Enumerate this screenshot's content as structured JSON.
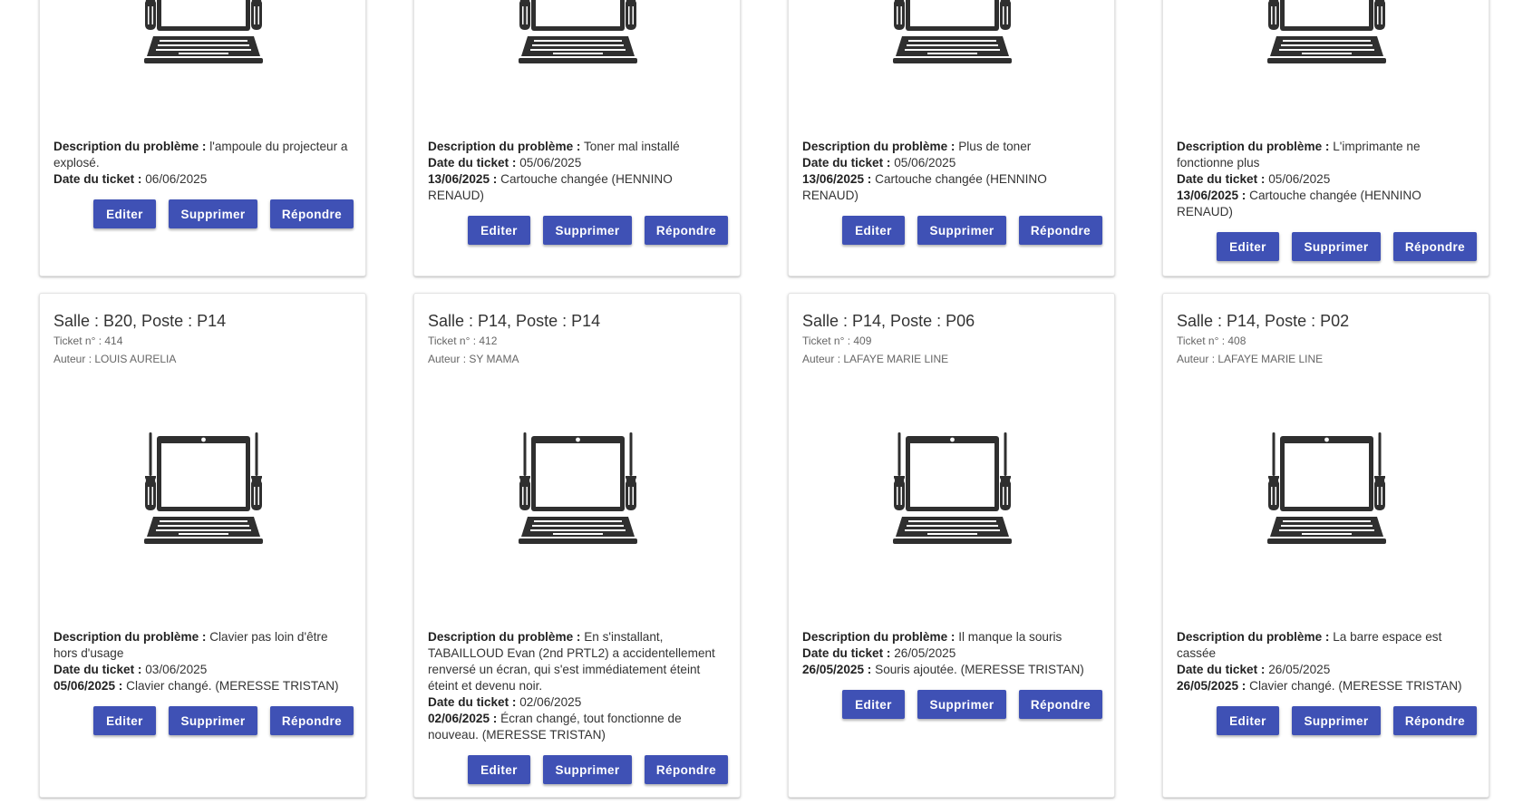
{
  "labels": {
    "description": "Description du problème :",
    "date": "Date du ticket :",
    "edit": "Editer",
    "delete": "Supprimer",
    "reply": "Répondre"
  },
  "colors": {
    "primary_button": "#3f51b5",
    "illustration": "#2f2f2f"
  },
  "illustration_icon": "laptop-repair-icon",
  "top_cards": [
    {
      "description": "l'ampoule du projecteur a explosé.",
      "date": "06/06/2025",
      "responses": []
    },
    {
      "description": "Toner mal installé",
      "date": "05/06/2025",
      "responses": [
        {
          "date": "13/06/2025 :",
          "text": "Cartouche changée (HENNINO RENAUD)"
        }
      ]
    },
    {
      "description": "Plus de toner",
      "date": "05/06/2025",
      "responses": [
        {
          "date": "13/06/2025 :",
          "text": "Cartouche changée (HENNINO RENAUD)"
        }
      ]
    },
    {
      "description": "L'imprimante ne fonctionne plus",
      "date": "05/06/2025",
      "responses": [
        {
          "date": "13/06/2025 :",
          "text": "Cartouche changée (HENNINO RENAUD)"
        }
      ]
    }
  ],
  "bottom_cards": [
    {
      "title": "Salle : B20, Poste : P14",
      "ticket": "Ticket n° : 414",
      "author": "Auteur : LOUIS AURELIA",
      "description": "Clavier pas loin d'être hors d'usage",
      "date": "03/06/2025",
      "responses": [
        {
          "date": "05/06/2025 :",
          "text": "Clavier changé. (MERESSE TRISTAN)"
        }
      ]
    },
    {
      "title": "Salle : P14, Poste : P14",
      "ticket": "Ticket n° : 412",
      "author": "Auteur : SY MAMA",
      "description": "En s'installant, TABAILLOUD Evan (2nd PRTL2) a accidentellement renversé un écran, qui s'est immédiatement éteint éteint et devenu noir.",
      "date": "02/06/2025",
      "responses": [
        {
          "date": "02/06/2025 :",
          "text": "Écran changé, tout fonctionne de nouveau. (MERESSE TRISTAN)"
        }
      ]
    },
    {
      "title": "Salle : P14, Poste : P06",
      "ticket": "Ticket n° : 409",
      "author": "Auteur : LAFAYE MARIE LINE",
      "description": "Il manque la souris",
      "date": "26/05/2025",
      "responses": [
        {
          "date": "26/05/2025 :",
          "text": "Souris ajoutée. (MERESSE TRISTAN)"
        }
      ]
    },
    {
      "title": "Salle : P14, Poste : P02",
      "ticket": "Ticket n° : 408",
      "author": "Auteur : LAFAYE MARIE LINE",
      "description": "La barre espace est cassée",
      "date": "26/05/2025",
      "responses": [
        {
          "date": "26/05/2025 :",
          "text": "Clavier changé. (MERESSE TRISTAN)"
        }
      ]
    }
  ]
}
